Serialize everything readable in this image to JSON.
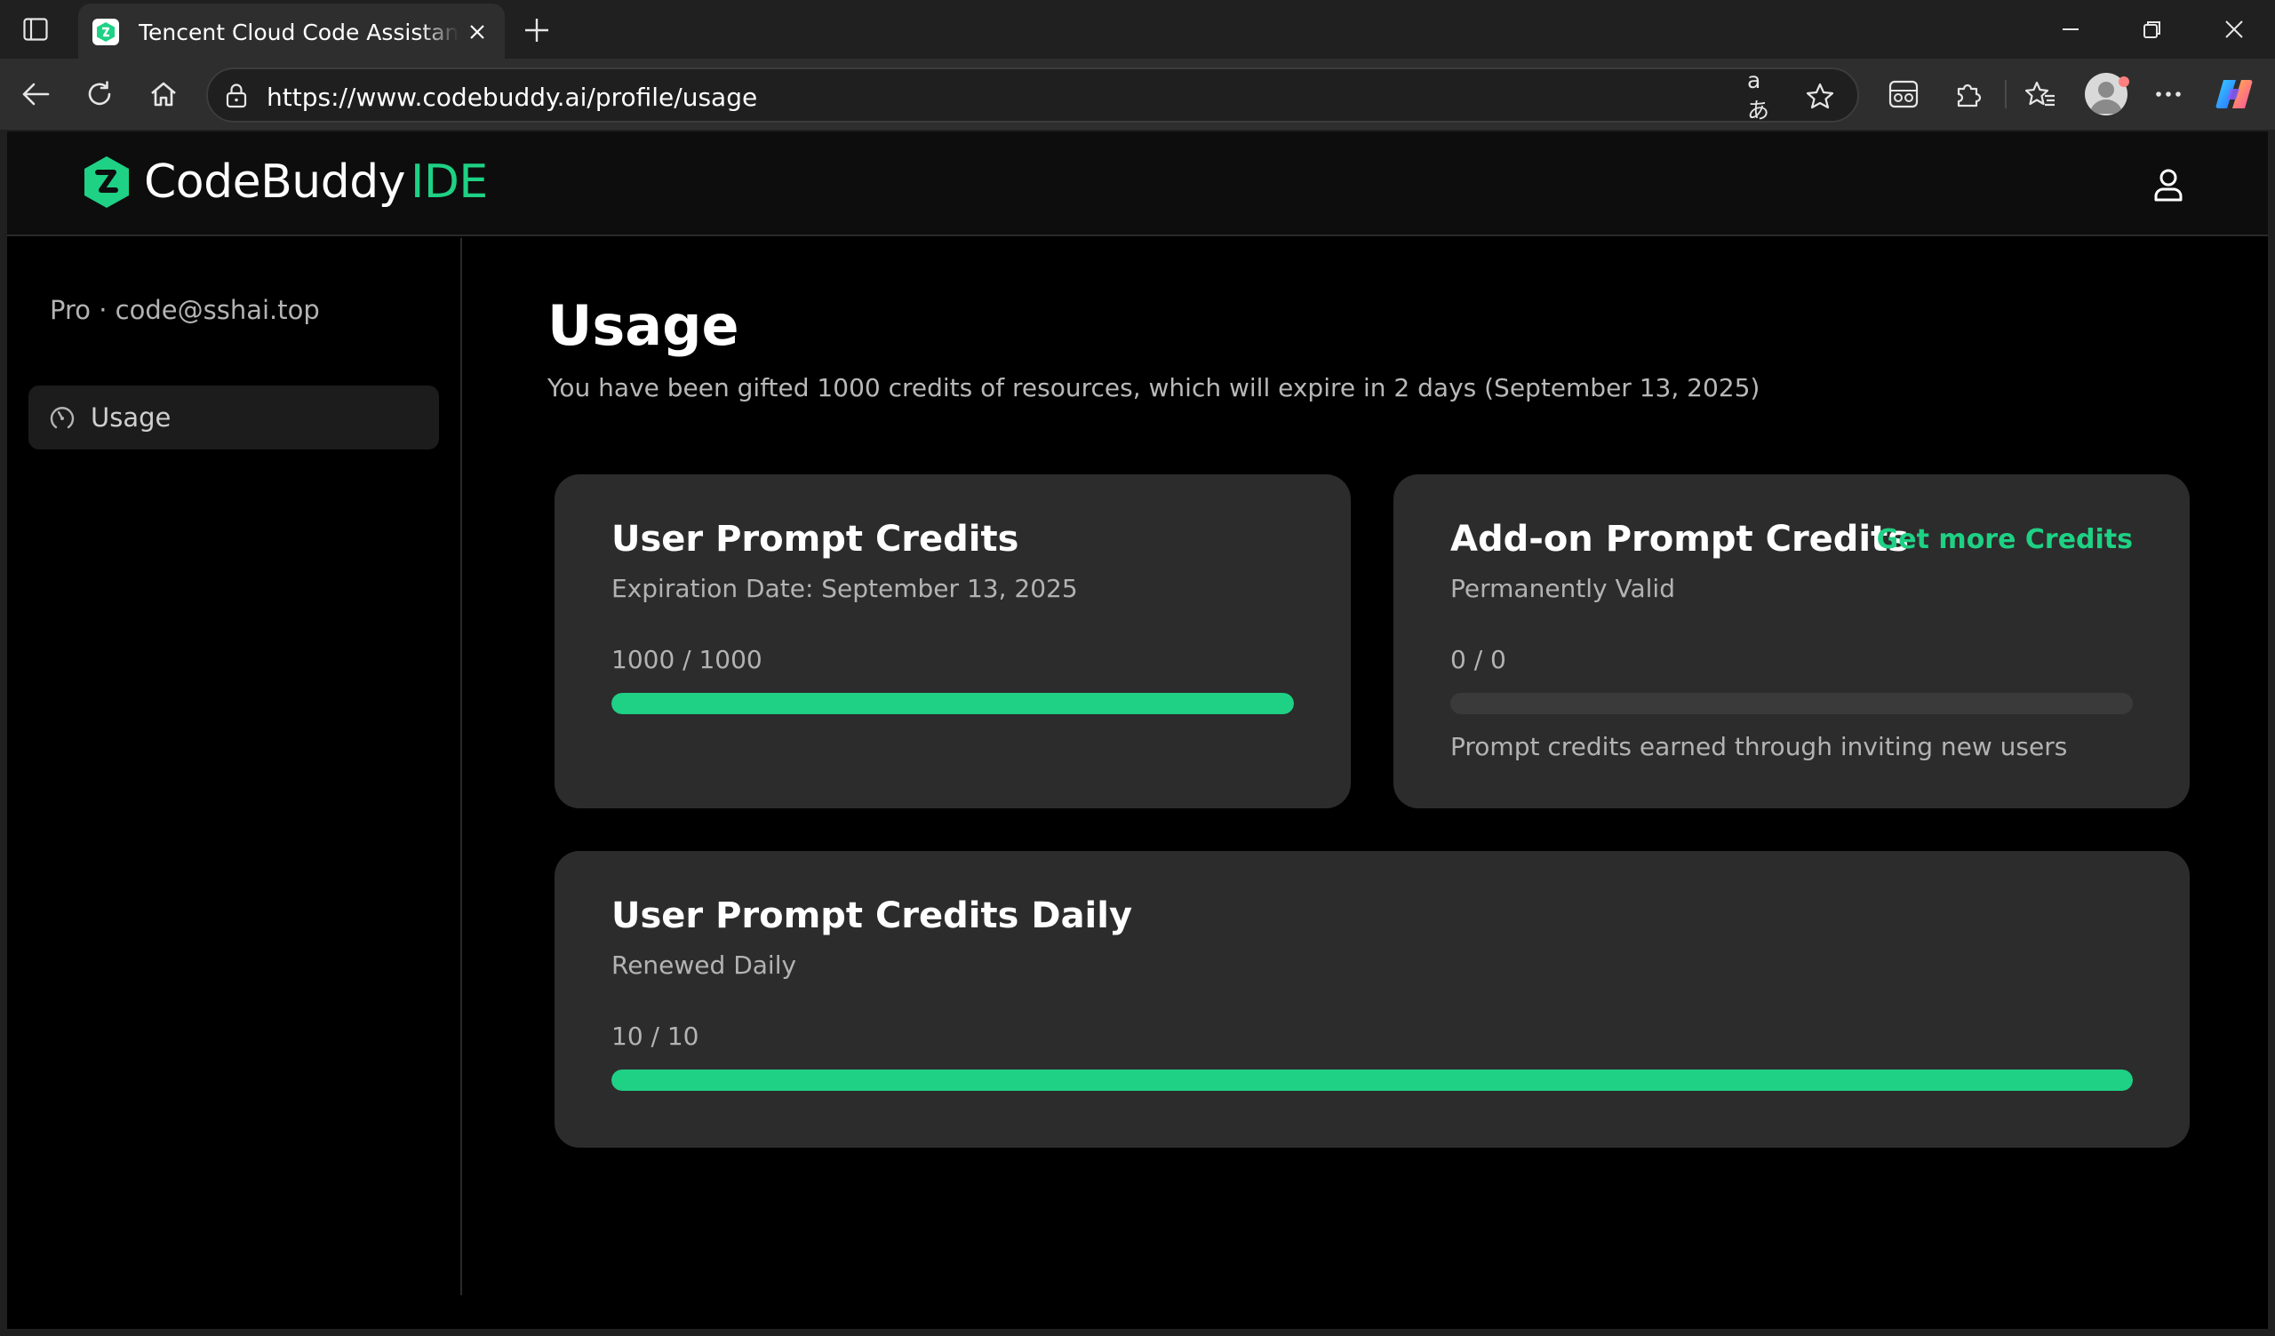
{
  "browser": {
    "tab_title": "Tencent Cloud Code Assistant CodeBuddy",
    "url": "https://www.codebuddy.ai/profile/usage"
  },
  "header": {
    "logo_name": "CodeBuddy",
    "logo_suffix": "IDE"
  },
  "sidebar": {
    "account": "Pro · code@sshai.top",
    "items": [
      {
        "label": "Usage",
        "icon": "gauge-icon",
        "active": true
      }
    ]
  },
  "main": {
    "title": "Usage",
    "subtitle": "You have been gifted 1000 credits of resources, which will expire in 2 days (September 13, 2025)",
    "cards": [
      {
        "title": "User Prompt Credits",
        "subtitle": "Expiration Date: September 13, 2025",
        "count": "1000 / 1000",
        "progress": 1.0
      },
      {
        "title": "Add-on Prompt Credits",
        "link": "Get more Credits",
        "subtitle": "Permanently Valid",
        "count": "0 / 0",
        "progress": 0,
        "note": "Prompt credits earned through inviting new users"
      },
      {
        "title": "User Prompt Credits Daily",
        "subtitle": "Renewed Daily",
        "count": "10 / 10",
        "progress": 1.0
      }
    ]
  },
  "colors": {
    "accent": "#1ed184",
    "card_bg": "#2c2c2c",
    "page_bg": "#000000"
  }
}
